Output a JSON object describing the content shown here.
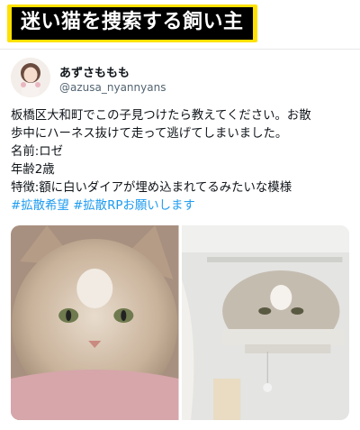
{
  "banner": {
    "title": "迷い猫を捜索する飼い主"
  },
  "author": {
    "display_name": "あずさももも",
    "handle": "@azusa_nyannyans"
  },
  "tweet": {
    "lines": [
      "板橋区大和町でこの子見つけたら教えてください。お散",
      "歩中にハーネス抜けて走って逃げてしまいました。",
      "名前:ロゼ",
      "年齢2歳",
      "特徴:額に白いダイアが埋め込まれてるみたいな模様"
    ],
    "hashtag_1": "#拡散希望",
    "hashtag_2": "#拡散RPお願いします"
  },
  "photos": [
    {
      "icon": "cat-photo-1"
    },
    {
      "icon": "cat-photo-2"
    }
  ],
  "colors": {
    "banner_bg": "#ffe100",
    "banner_text": "#ffffff",
    "link": "#1d9bf0"
  }
}
